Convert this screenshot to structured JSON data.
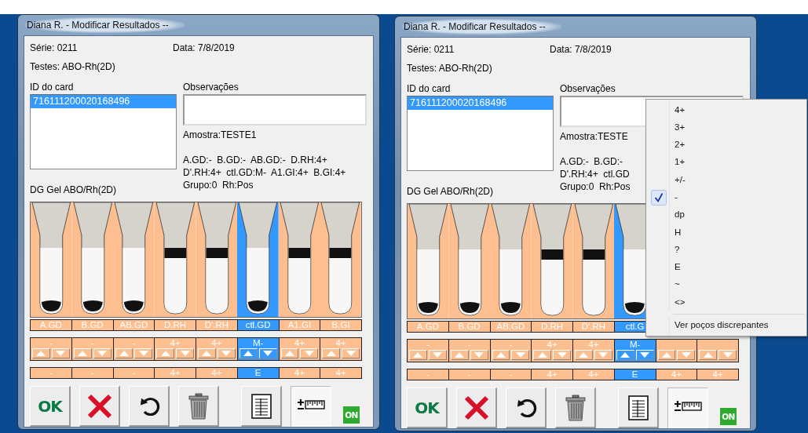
{
  "windows": [
    {
      "title": "Diana R. - Modificar Resultados --",
      "serie": "Série: 0211",
      "data": "Data: 7/8/2019",
      "testes": "Testes: ABO-Rh(2D)",
      "id_label": "ID do card",
      "id_items": [
        {
          "text": "716111200020168496",
          "selected": true
        }
      ],
      "obs_label": "Observações",
      "amostra": "Amostra:TESTE1",
      "result_lines": [
        "A.GD:-  B.GD:-  AB.GD:-  D.RH:4+",
        "D'.RH:4+  ctl.GD:M-  A1.GI:4+  B.GI:4+",
        "Grupo:0  Rh:Pos"
      ],
      "card_type": "DG Gel ABO/Rh(2D)",
      "tubes": [
        {
          "label": "A.GD",
          "reading": "-",
          "result": "-",
          "kind": "settled",
          "selected": false
        },
        {
          "label": "B.GD",
          "reading": "-",
          "result": "-",
          "kind": "settled",
          "selected": false
        },
        {
          "label": "AB.GD",
          "reading": "-",
          "result": "-",
          "kind": "settled",
          "selected": false
        },
        {
          "label": "D.RH",
          "reading": "4+",
          "result": "4+",
          "kind": "agglutinated",
          "selected": false
        },
        {
          "label": "D'.RH",
          "reading": "4+",
          "result": "4+",
          "kind": "agglutinated",
          "selected": false
        },
        {
          "label": "ctl.GD",
          "reading": "M-",
          "result": "E",
          "kind": "settled",
          "selected": true
        },
        {
          "label": "A1.GI",
          "reading": "4+",
          "result": "4+",
          "kind": "agglutinated",
          "selected": false
        },
        {
          "label": "B.GI",
          "reading": "4+",
          "result": "4+",
          "kind": "agglutinated",
          "selected": false
        }
      ],
      "buttons": [
        {
          "kind": "ok",
          "label": "OK",
          "pressed": false
        },
        {
          "kind": "cancel",
          "pressed": false
        },
        {
          "kind": "undo",
          "pressed": false
        },
        {
          "kind": "delete",
          "pressed": false
        },
        {
          "kind": "report",
          "pressed": false
        },
        {
          "kind": "scale",
          "pressed": true
        }
      ],
      "indicator": "ON"
    },
    {
      "title": "Diana R. - Modificar Resultados --",
      "serie": "Série: 0211",
      "data": "Data: 7/8/2019",
      "testes": "Testes: ABO-Rh(2D)",
      "id_label": "ID do card",
      "id_items": [
        {
          "text": "716111200020168496",
          "selected": true
        }
      ],
      "obs_label": "Observações",
      "amostra": "Amostra:TESTE",
      "result_lines": [
        "A.GD:-  B.GD:-",
        "D'.RH:4+  ctl.GD",
        "Grupo:0  Rh:Pos"
      ],
      "card_type": "DG Gel ABO/Rh(2D)",
      "tubes": [
        {
          "label": "A.GD",
          "reading": "-",
          "result": "-",
          "kind": "settled",
          "selected": false
        },
        {
          "label": "B.GD",
          "reading": "-",
          "result": "-",
          "kind": "settled",
          "selected": false
        },
        {
          "label": "AB.GD",
          "reading": "-",
          "result": "-",
          "kind": "settled",
          "selected": false
        },
        {
          "label": "D.RH",
          "reading": "4+",
          "result": "4+",
          "kind": "agglutinated",
          "selected": false
        },
        {
          "label": "D'.RH",
          "reading": "4+",
          "result": "4+",
          "kind": "agglutinated",
          "selected": false
        },
        {
          "label": "ctl.G",
          "reading": "M-",
          "result": "E",
          "kind": "settled",
          "selected": true
        },
        {
          "result": "4+",
          "selected": false
        },
        {
          "result": "4+",
          "selected": false
        }
      ],
      "buttons": [
        {
          "kind": "ok",
          "label": "OK",
          "pressed": false
        },
        {
          "kind": "cancel",
          "pressed": false
        },
        {
          "kind": "undo",
          "pressed": false
        },
        {
          "kind": "delete",
          "pressed": false
        },
        {
          "kind": "report",
          "pressed": false
        },
        {
          "kind": "scale",
          "pressed": true
        }
      ],
      "indicator": "ON"
    }
  ],
  "context_menu": {
    "items": [
      {
        "label": "4+",
        "checked": false
      },
      {
        "label": "3+",
        "checked": false
      },
      {
        "label": "2+",
        "checked": false
      },
      {
        "label": "1+",
        "checked": false
      },
      {
        "label": "+/-",
        "checked": false
      },
      {
        "label": "-",
        "checked": true
      },
      {
        "label": "dp",
        "checked": false
      },
      {
        "label": "H",
        "checked": false
      },
      {
        "label": "?",
        "checked": false
      },
      {
        "label": "E",
        "checked": false
      },
      {
        "label": "~",
        "checked": false
      },
      {
        "label": "<>",
        "checked": false
      }
    ],
    "action": "Ver poços discrepantes"
  }
}
